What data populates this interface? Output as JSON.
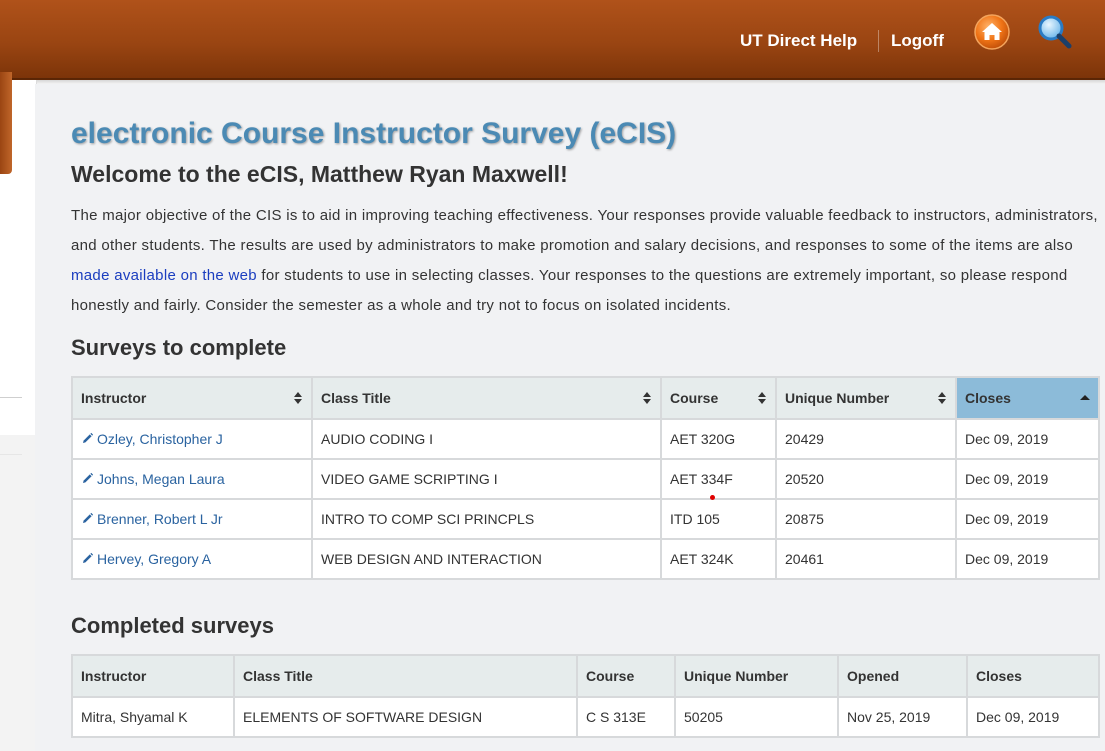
{
  "header": {
    "help_label": "UT Direct Help",
    "logoff_label": "Logoff",
    "home_icon": "home-icon",
    "search_icon": "search-icon",
    "brand_color": "#9a4512"
  },
  "page": {
    "title": "electronic Course Instructor Survey (eCIS)",
    "welcome": "Welcome to the eCIS, Matthew Ryan Maxwell!",
    "intro_before": "The major objective of the CIS is to aid in improving teaching effectiveness. Your responses provide valuable feedback to instructors, administrators, and other students. The results are used by administrators to make promotion and salary decisions, and responses to some of the items are also ",
    "intro_link": "made available on the web",
    "intro_after": " for students to use in selecting classes. Your responses to the questions are extremely important, so please respond honestly and fairly. Consider the semester as a whole and try not to focus on isolated incidents."
  },
  "to_complete": {
    "heading": "Surveys to complete",
    "headers": [
      "Instructor",
      "Class Title",
      "Course",
      "Unique Number",
      "Closes"
    ],
    "sorted_column": "Closes",
    "rows": [
      {
        "instructor": "Ozley, Christopher J",
        "class_title": "AUDIO CODING I",
        "course": "AET 320G",
        "unique": "20429",
        "closes": "Dec 09, 2019"
      },
      {
        "instructor": "Johns, Megan Laura",
        "class_title": "VIDEO GAME SCRIPTING I",
        "course": "AET 334F",
        "unique": "20520",
        "closes": "Dec 09, 2019"
      },
      {
        "instructor": "Brenner, Robert L Jr",
        "class_title": "INTRO TO COMP SCI PRINCPLS",
        "course": "ITD 105",
        "unique": "20875",
        "closes": "Dec 09, 2019"
      },
      {
        "instructor": "Hervey, Gregory A",
        "class_title": "WEB DESIGN AND INTERACTION",
        "course": "AET 324K",
        "unique": "20461",
        "closes": "Dec 09, 2019"
      }
    ]
  },
  "completed": {
    "heading": "Completed surveys",
    "headers": [
      "Instructor",
      "Class Title",
      "Course",
      "Unique Number",
      "Opened",
      "Closes"
    ],
    "rows": [
      {
        "instructor": "Mitra, Shyamal K",
        "class_title": "ELEMENTS OF SOFTWARE DESIGN",
        "course": "C S 313E",
        "unique": "50205",
        "opened": "Nov 25, 2019",
        "closes": "Dec 09, 2019"
      }
    ]
  }
}
